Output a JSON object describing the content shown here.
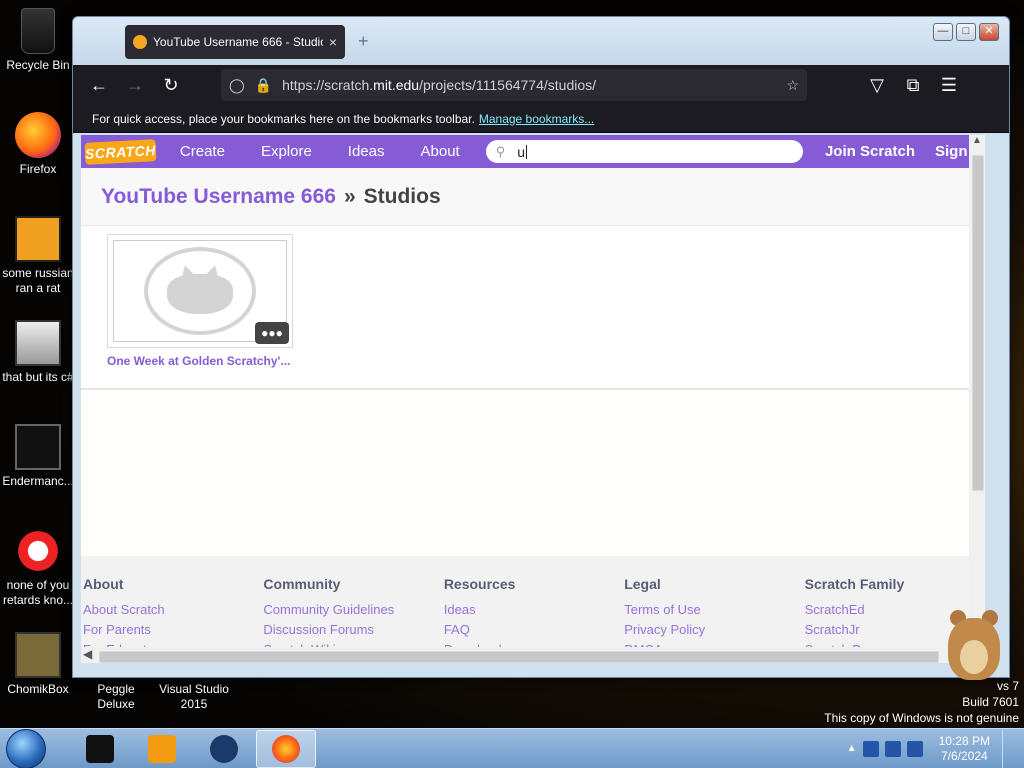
{
  "desktop": {
    "icons": [
      {
        "label": "Recycle Bin"
      },
      {
        "label": "Firefox"
      },
      {
        "label": "some russian ran a rat"
      },
      {
        "label": "that but its c#"
      },
      {
        "label": "Endermanc..."
      },
      {
        "label": "none of you retards kno..."
      },
      {
        "label": "ChomikBox"
      },
      {
        "label": "Peggle Deluxe"
      },
      {
        "label": "Visual Studio 2015"
      }
    ],
    "watermark": {
      "line1": "vs 7",
      "line2": "Build 7601",
      "line3": "This copy of Windows is not genuine"
    }
  },
  "browser": {
    "tab_title": "YouTube Username 666 - Studios",
    "tab_close": "×",
    "new_tab": "+",
    "url_prefix": "https://scratch.",
    "url_domain": "mit.edu",
    "url_suffix": "/projects/111564774/studios/",
    "bookmarks_text": "For quick access, place your bookmarks here on the bookmarks toolbar.",
    "bookmarks_link": "Manage bookmarks..."
  },
  "scratch": {
    "logo": "SCRATCH",
    "nav": [
      "Create",
      "Explore",
      "Ideas",
      "About"
    ],
    "search_value": "u",
    "join": "Join Scratch",
    "signin": "Sign in",
    "breadcrumb_project": "YouTube Username 666",
    "breadcrumb_sep": "»",
    "breadcrumb_page": "Studios",
    "studio_title": "One Week at Golden Scratchy'...",
    "footer": [
      {
        "heading": "About",
        "links": [
          "About Scratch",
          "For Parents",
          "For Educators"
        ]
      },
      {
        "heading": "Community",
        "links": [
          "Community Guidelines",
          "Discussion Forums",
          "Scratch Wiki"
        ]
      },
      {
        "heading": "Resources",
        "links": [
          "Ideas",
          "FAQ",
          "Download"
        ]
      },
      {
        "heading": "Legal",
        "links": [
          "Terms of Use",
          "Privacy Policy",
          "DMCA"
        ]
      },
      {
        "heading": "Scratch Family",
        "links": [
          "ScratchEd",
          "ScratchJr",
          "Scratch Day"
        ]
      }
    ]
  },
  "taskbar": {
    "time": "10:28 PM",
    "date": "7/6/2024"
  },
  "colors": {
    "scratch_purple": "#855cd6",
    "firefox_dark": "#1c1b22",
    "link_cyan": "#80ebff"
  }
}
